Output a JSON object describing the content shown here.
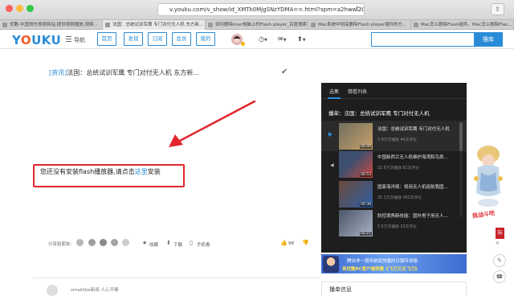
{
  "browser": {
    "url": "v.youku.com/v_show/id_XMTk0MjgSNzYDMA==.html?spm=a2hww.20023042.m_22346...",
    "tabs": [
      {
        "label": "优酷-中国领先视频网站,提供视频播放,视频..."
      },
      {
        "label": "法国：总统试训军鹰 专门对付无人机 东方新..."
      },
      {
        "label": "如何删除mac电脑上的Flash player_百度搜索"
      },
      {
        "label": "Mac系统中彻底删除Flash player插件的方..."
      },
      {
        "label": "Mac怎么删除Flash插件。Mac怎么删除Flas..."
      }
    ]
  },
  "header": {
    "logo": "YOUKU",
    "nav_label": "导航",
    "nav_buttons": [
      "首页",
      "发现",
      "订阅",
      "会员",
      "我的"
    ],
    "search_button": "搜库"
  },
  "video": {
    "title_tag": "[资讯]",
    "title_text": "法国：总统试训军鹰 专门对付无人机 东方新...",
    "flash_message": "您还没有安装flash播放器,请点击",
    "flash_link": "这里",
    "flash_suffix": "安装"
  },
  "share": {
    "label": "分享给朋友:",
    "actions": [
      "收藏",
      "下载",
      "手机看"
    ],
    "like_count": "98"
  },
  "side": {
    "tabs": [
      "选集",
      "猜看列表"
    ],
    "now_playing_label": "播单：法国：总统试训军鹰 专门对付无人机",
    "items": [
      {
        "title": "法国：总统试训军鹰 专门对付无人机",
        "meta": "5.9万次播放 44次评论",
        "duration": "00:49",
        "thumb_colors": [
          "#7c7d6a",
          "#c9a06a"
        ]
      },
      {
        "title": "中国新西兰无人机维护海湾和鸟类...",
        "meta": "32.6万次播放 81次评论",
        "duration": "00:53",
        "thumb_colors": [
          "#3e4f6f",
          "#cf4a3b"
        ]
      },
      {
        "title": "国家海洋局：将用无人机巡航我国...",
        "meta": "35.1万次播放 362次评论",
        "duration": "00:38",
        "thumb_colors": [
          "#6b4a3b",
          "#2e5ea3"
        ]
      },
      {
        "title": "防控境角新技能：国外男子用无人...",
        "meta": "5.5万次播放 33次评论",
        "duration": "02:27",
        "thumb_colors": [
          "#4a5668",
          "#a8b3c4"
        ]
      }
    ],
    "ad_line1": "腾出非一般传统就快魔的日服传说格",
    "ad_line2": "来优酷PC客户端观看《飞刀又见飞刀》"
  },
  "game": {
    "title": "我战斗吧",
    "stamp": "玩"
  },
  "bottom": {
    "user_text": "smaklibe新闻",
    "user_sub": "人心不稀",
    "section_label": "播单信息"
  },
  "colors": {
    "accent": "#2a8cd8",
    "highlight_border": "#e1262d",
    "panel_bg": "#1e1e1e"
  }
}
